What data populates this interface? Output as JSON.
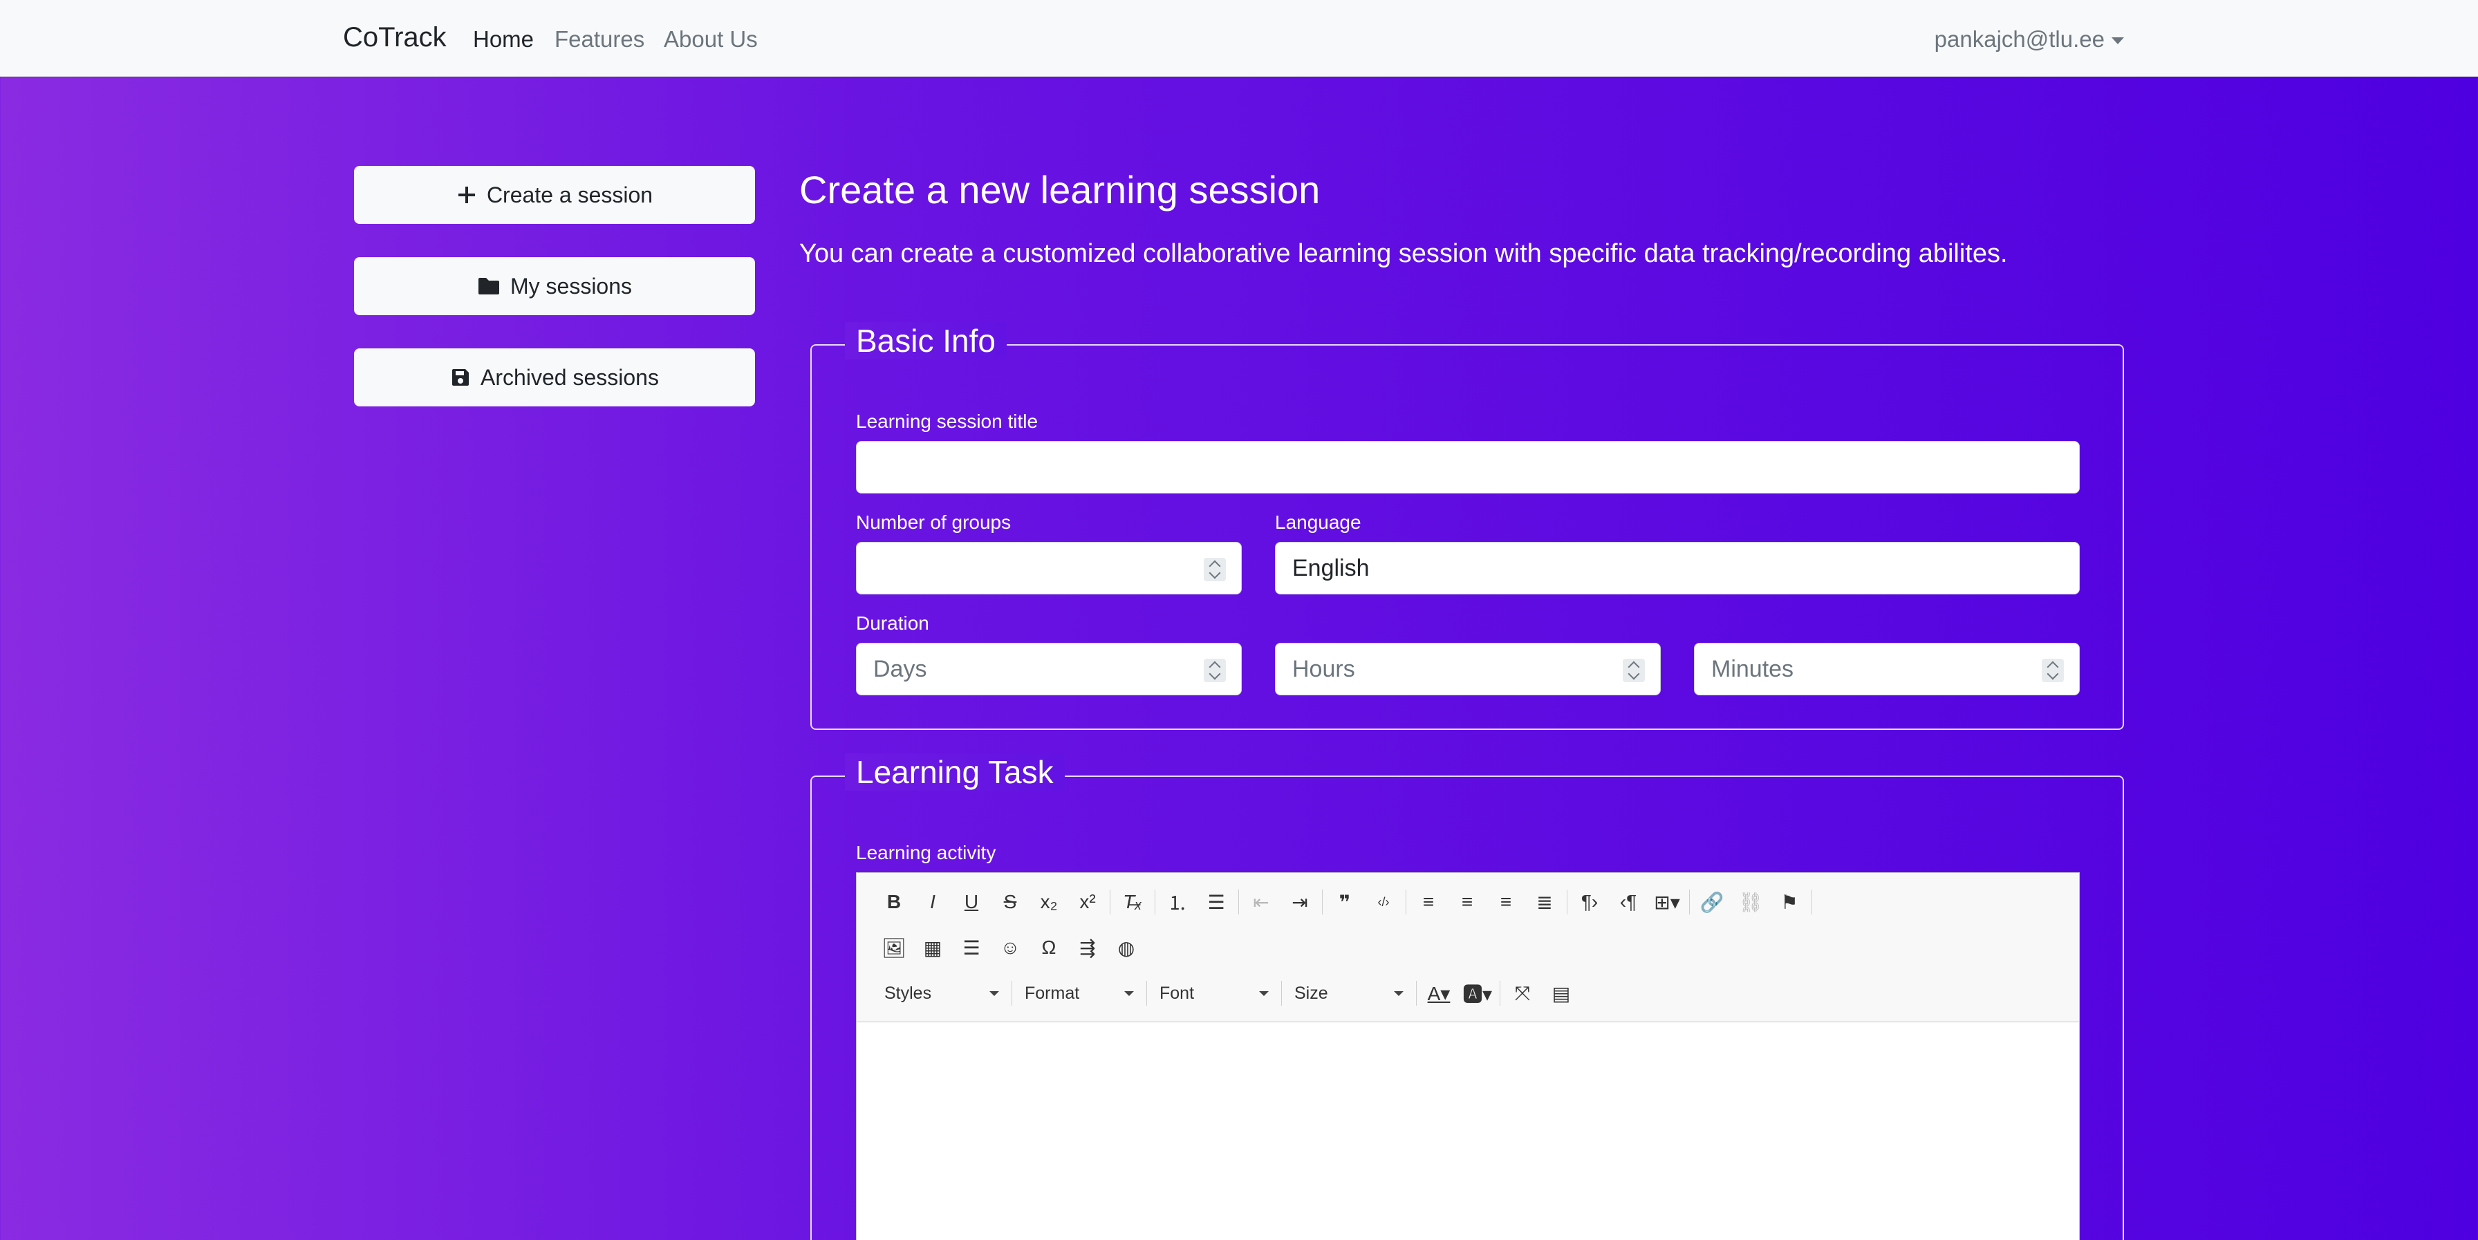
{
  "navbar": {
    "brand": "CoTrack",
    "links": [
      "Home",
      "Features",
      "About Us"
    ],
    "user": "pankajch@tlu.ee"
  },
  "sidebar": {
    "buttons": [
      {
        "label": "Create a session",
        "icon": "plus-icon"
      },
      {
        "label": "My sessions",
        "icon": "folder-icon"
      },
      {
        "label": "Archived sessions",
        "icon": "save-icon"
      }
    ]
  },
  "main": {
    "title": "Create a new learning session",
    "subtitle": "You can create a customized collaborative learning session with specific data tracking/recording abilites."
  },
  "basic_info": {
    "legend": "Basic Info",
    "title_label": "Learning session title",
    "title_value": "",
    "groups_label": "Number of groups",
    "groups_value": "",
    "language_label": "Language",
    "language_value": "English",
    "duration_label": "Duration",
    "days_placeholder": "Days",
    "hours_placeholder": "Hours",
    "minutes_placeholder": "Minutes"
  },
  "learning_task": {
    "legend": "Learning Task",
    "activity_label": "Learning activity",
    "editor": {
      "combos": [
        "Styles",
        "Format",
        "Font",
        "Size"
      ],
      "content": ""
    }
  },
  "colors": {
    "gradient_start": "#8a2be2",
    "gradient_end": "#4f00e0",
    "navbar_bg": "#f8f9fa"
  }
}
